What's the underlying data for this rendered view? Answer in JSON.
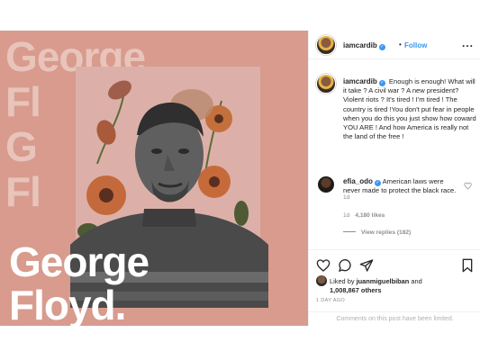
{
  "artwork": {
    "bg_words": [
      "George",
      "Fl",
      "G",
      "Fl",
      "G"
    ],
    "headline_first": "George",
    "headline_last": "Floyd."
  },
  "header": {
    "username": "iamcardib",
    "verified_mark": "✓",
    "separator": "•",
    "follow_label": "Follow",
    "more_label": "..."
  },
  "caption": {
    "username": "iamcardib",
    "verified_mark": "✓",
    "text": "Enough is enough! What will it take ? A civil war ? A new president? Violent riots ? It's tired ! I'm tired ! The country is tired !You don't put fear in people when you do this you just show how coward YOU ARE ! And how America is really not the land of the free !",
    "time": "1d"
  },
  "comment": {
    "username": "efia_odo",
    "verified_mark": "✓",
    "text": "American laws were never made to protect the black race.",
    "time": "1d",
    "likes": "4,180 likes",
    "view_replies": "View replies (182)"
  },
  "likes_summary": {
    "prefix": "Liked by",
    "user": "juanmiguelbiban",
    "joiner": "and",
    "count": "1,008,867 others"
  },
  "time_ago": "1 DAY AGO",
  "comments_limited": "Comments on this post have been limited.",
  "icons": [
    "heart-icon",
    "comment-icon",
    "share-icon",
    "bookmark-icon",
    "more-icon"
  ],
  "colors": {
    "artwork_bg": "#d89b8e",
    "accent": "#3897f0",
    "muted": "#8e8e8e"
  }
}
